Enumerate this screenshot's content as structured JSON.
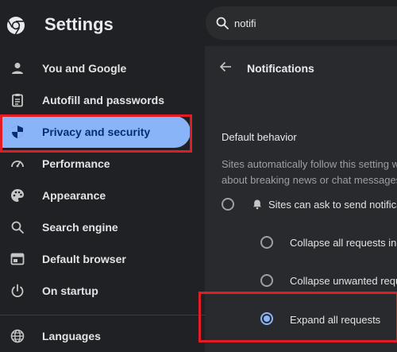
{
  "header": {
    "app_title": "Settings",
    "search": {
      "value": "notifi",
      "icon": "search-icon"
    },
    "logo_icon": "chrome-logo-icon"
  },
  "sidebar": {
    "items": [
      {
        "label": "You and Google",
        "icon": "person-icon"
      },
      {
        "label": "Autofill and passwords",
        "icon": "clipboard-icon"
      },
      {
        "label": "Privacy and security",
        "icon": "shield-icon",
        "active": true
      },
      {
        "label": "Performance",
        "icon": "speedometer-icon"
      },
      {
        "label": "Appearance",
        "icon": "palette-icon"
      },
      {
        "label": "Search engine",
        "icon": "search-icon"
      },
      {
        "label": "Default browser",
        "icon": "browser-icon"
      },
      {
        "label": "On startup",
        "icon": "power-icon"
      },
      {
        "label": "Languages",
        "icon": "globe-icon"
      }
    ]
  },
  "main": {
    "title": "Notifications",
    "back_icon": "arrow-left-icon",
    "section_title": "Default behavior",
    "description_lines": [
      "Sites automatically follow this setting w",
      "about breaking news or chat messages"
    ],
    "options": [
      {
        "label": "Sites can ask to send notificati",
        "icon": "bell-icon",
        "selected": false
      },
      {
        "label": "Collapse all requests in t",
        "selected": false
      },
      {
        "label": "Collapse unwanted requ",
        "selected": false
      },
      {
        "label": "Expand all requests",
        "selected": true
      }
    ]
  },
  "colors": {
    "background": "#202124",
    "panel": "#292a2d",
    "active_item": "#8ab4f8",
    "active_text": "#062e6f",
    "highlight_box": "#e21c24"
  }
}
